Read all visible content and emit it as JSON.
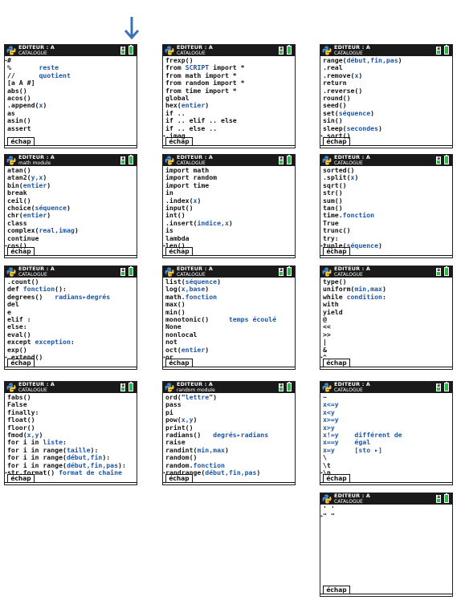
{
  "header": {
    "title": "ÉDITEUR : A",
    "subtitle_catalog": "CATALOGUE",
    "subtitle_math": "math module",
    "subtitle_random": "random module",
    "mode_indicator": "a"
  },
  "footer": {
    "escape_label": "échap"
  },
  "colors": {
    "header_bg": "#1a1a1a",
    "accent_blue": "#1c56a6",
    "battery_green": "#2db84a"
  },
  "screens": [
    {
      "subtitle": "CATALOGUE",
      "rows": [
        [
          {
            "t": "#"
          }
        ],
        [
          {
            "t": "%       "
          },
          {
            "t": "reste",
            "c": "blue"
          }
        ],
        [
          {
            "t": "//      "
          },
          {
            "t": "quotient",
            "c": "blue"
          }
        ],
        [
          {
            "t": "[a A #]"
          }
        ],
        [
          {
            "t": "abs()"
          }
        ],
        [
          {
            "t": "acos()"
          }
        ],
        [
          {
            "t": ".append("
          },
          {
            "t": "x",
            "c": "blue"
          },
          {
            "t": ")"
          }
        ],
        [
          {
            "t": "as"
          }
        ],
        [
          {
            "t": "asin()"
          }
        ],
        [
          {
            "t": "assert"
          }
        ]
      ],
      "markers": {
        "0": "▸"
      }
    },
    {
      "subtitle": "CATALOGUE",
      "rows": [
        [
          {
            "t": "frexp()"
          }
        ],
        [
          {
            "t": "from "
          },
          {
            "t": "SCRIPT",
            "c": "blue"
          },
          {
            "t": " import *"
          }
        ],
        [
          {
            "t": "from math import *"
          }
        ],
        [
          {
            "t": "from random import *"
          }
        ],
        [
          {
            "t": "from time import *"
          }
        ],
        [
          {
            "t": "global"
          }
        ],
        [
          {
            "t": "hex("
          },
          {
            "t": "entier",
            "c": "blue"
          },
          {
            "t": ")"
          }
        ],
        [
          {
            "t": "if .."
          }
        ],
        [
          {
            "t": "if .. elif .. else"
          }
        ],
        [
          {
            "t": "if .. else .."
          }
        ],
        [
          {
            "t": ".imag"
          }
        ]
      ],
      "markers": {
        "10": "▸"
      }
    },
    {
      "subtitle": "CATALOGUE",
      "rows": [
        [
          {
            "t": "range("
          },
          {
            "t": "début,fin,pas",
            "c": "blue"
          },
          {
            "t": ")"
          }
        ],
        [
          {
            "t": ".real"
          }
        ],
        [
          {
            "t": ".remove("
          },
          {
            "t": "x",
            "c": "blue"
          },
          {
            "t": ")"
          }
        ],
        [
          {
            "t": "return"
          }
        ],
        [
          {
            "t": ".reverse()"
          }
        ],
        [
          {
            "t": "round()"
          }
        ],
        [
          {
            "t": "seed()"
          }
        ],
        [
          {
            "t": "set("
          },
          {
            "t": "séquence",
            "c": "blue"
          },
          {
            "t": ")"
          }
        ],
        [
          {
            "t": "sin()"
          }
        ],
        [
          {
            "t": "sleep("
          },
          {
            "t": "secondes",
            "c": "blue"
          },
          {
            "t": ")"
          }
        ],
        [
          {
            "t": ".sort()"
          }
        ]
      ],
      "markers": {
        "10": "▸"
      }
    },
    {
      "subtitle": "math module",
      "rows": [
        [
          {
            "t": "atan()"
          }
        ],
        [
          {
            "t": "atan2("
          },
          {
            "t": "y,x",
            "c": "blue"
          },
          {
            "t": ")"
          }
        ],
        [
          {
            "t": "bin("
          },
          {
            "t": "entier",
            "c": "blue"
          },
          {
            "t": ")"
          }
        ],
        [
          {
            "t": "break"
          }
        ],
        [
          {
            "t": "ceil()"
          }
        ],
        [
          {
            "t": "choice("
          },
          {
            "t": "séquence",
            "c": "blue"
          },
          {
            "t": ")"
          }
        ],
        [
          {
            "t": "chr("
          },
          {
            "t": "entier",
            "c": "blue"
          },
          {
            "t": ")"
          }
        ],
        [
          {
            "t": "class"
          }
        ],
        [
          {
            "t": "complex("
          },
          {
            "t": "real,imag",
            "c": "blue"
          },
          {
            "t": ")"
          }
        ],
        [
          {
            "t": "continue"
          }
        ],
        [
          {
            "t": "cos()"
          }
        ]
      ],
      "markers": {
        "10": "▸"
      }
    },
    {
      "subtitle": "CATALOGUE",
      "rows": [
        [
          {
            "t": "import math"
          }
        ],
        [
          {
            "t": "import random"
          }
        ],
        [
          {
            "t": "import time"
          }
        ],
        [
          {
            "t": "in"
          }
        ],
        [
          {
            "t": ".index("
          },
          {
            "t": "x",
            "c": "blue"
          },
          {
            "t": ")"
          }
        ],
        [
          {
            "t": "input()"
          }
        ],
        [
          {
            "t": "int()"
          }
        ],
        [
          {
            "t": ".insert("
          },
          {
            "t": "indice,x",
            "c": "blue"
          },
          {
            "t": ")"
          }
        ],
        [
          {
            "t": "is"
          }
        ],
        [
          {
            "t": "lambda"
          }
        ],
        [
          {
            "t": "len()"
          }
        ]
      ],
      "markers": {
        "10": "▸"
      }
    },
    {
      "subtitle": "CATALOGUE",
      "rows": [
        [
          {
            "t": "sorted()"
          }
        ],
        [
          {
            "t": ".split("
          },
          {
            "t": "x",
            "c": "blue"
          },
          {
            "t": ")"
          }
        ],
        [
          {
            "t": "sqrt()"
          }
        ],
        [
          {
            "t": "str()"
          }
        ],
        [
          {
            "t": "sum()"
          }
        ],
        [
          {
            "t": "tan()"
          }
        ],
        [
          {
            "t": "time."
          },
          {
            "t": "fonction",
            "c": "blue"
          }
        ],
        [
          {
            "t": "True"
          }
        ],
        [
          {
            "t": "trunc()"
          }
        ],
        [
          {
            "t": "try:"
          }
        ],
        [
          {
            "t": "tuple("
          },
          {
            "t": "séquence",
            "c": "blue"
          },
          {
            "t": ")"
          }
        ]
      ],
      "markers": {
        "10": "▸"
      }
    },
    {
      "subtitle": "CATALOGUE",
      "rows": [
        [
          {
            "t": ".count()"
          }
        ],
        [
          {
            "t": "def "
          },
          {
            "t": "fonction",
            "c": "blue"
          },
          {
            "t": "():"
          }
        ],
        [
          {
            "t": "degrees()   "
          },
          {
            "t": "radians▸degrés",
            "c": "blue"
          }
        ],
        [
          {
            "t": "del"
          }
        ],
        [
          {
            "t": "e"
          }
        ],
        [
          {
            "t": "elif :"
          }
        ],
        [
          {
            "t": "else:"
          }
        ],
        [
          {
            "t": "eval()"
          }
        ],
        [
          {
            "t": "except "
          },
          {
            "t": "exception",
            "c": "blue"
          },
          {
            "t": ":"
          }
        ],
        [
          {
            "t": "exp()"
          }
        ],
        [
          {
            "t": ".extend()"
          }
        ]
      ],
      "markers": {
        "10": "▸"
      }
    },
    {
      "subtitle": "CATALOGUE",
      "rows": [
        [
          {
            "t": "list("
          },
          {
            "t": "séquence",
            "c": "blue"
          },
          {
            "t": ")"
          }
        ],
        [
          {
            "t": "log("
          },
          {
            "t": "x,base",
            "c": "blue"
          },
          {
            "t": ")"
          }
        ],
        [
          {
            "t": "math."
          },
          {
            "t": "fonction",
            "c": "blue"
          }
        ],
        [
          {
            "t": "max()"
          }
        ],
        [
          {
            "t": "min()"
          }
        ],
        [
          {
            "t": "monotonic()     "
          },
          {
            "t": "temps écoulé",
            "c": "blue"
          }
        ],
        [
          {
            "t": "None"
          }
        ],
        [
          {
            "t": "nonlocal"
          }
        ],
        [
          {
            "t": "not"
          }
        ],
        [
          {
            "t": "oct("
          },
          {
            "t": "entier",
            "c": "blue"
          },
          {
            "t": ")"
          }
        ],
        [
          {
            "t": "or"
          }
        ]
      ],
      "markers": {
        "10": "▸"
      }
    },
    {
      "subtitle": "CATALOGUE",
      "rows": [
        [
          {
            "t": "type()"
          }
        ],
        [
          {
            "t": "uniform("
          },
          {
            "t": "min,max",
            "c": "blue"
          },
          {
            "t": ")"
          }
        ],
        [
          {
            "t": "while "
          },
          {
            "t": "condition",
            "c": "blue"
          },
          {
            "t": ":"
          }
        ],
        [
          {
            "t": "with"
          }
        ],
        [
          {
            "t": "yield"
          }
        ],
        [
          {
            "t": "@"
          }
        ],
        [
          {
            "t": "<<"
          }
        ],
        [
          {
            "t": ">>"
          }
        ],
        [
          {
            "t": "|"
          }
        ],
        [
          {
            "t": "&"
          }
        ],
        [
          {
            "t": "^"
          }
        ]
      ],
      "markers": {
        "10": "▸"
      }
    },
    {
      "subtitle": "CATALOGUE",
      "rows": [
        [
          {
            "t": "fabs()"
          }
        ],
        [
          {
            "t": "False"
          }
        ],
        [
          {
            "t": "finally:"
          }
        ],
        [
          {
            "t": "float()"
          }
        ],
        [
          {
            "t": "floor()"
          }
        ],
        [
          {
            "t": "fmod("
          },
          {
            "t": "x,y",
            "c": "blue"
          },
          {
            "t": ")"
          }
        ],
        [
          {
            "t": "for i in "
          },
          {
            "t": "liste",
            "c": "blue"
          },
          {
            "t": ":"
          }
        ],
        [
          {
            "t": "for i in range("
          },
          {
            "t": "taille",
            "c": "blue"
          },
          {
            "t": "):"
          }
        ],
        [
          {
            "t": "for i in range("
          },
          {
            "t": "début,fin",
            "c": "blue"
          },
          {
            "t": "):"
          }
        ],
        [
          {
            "t": "for i in range("
          },
          {
            "t": "début,fin,pas",
            "c": "blue"
          },
          {
            "t": "):"
          }
        ],
        [
          {
            "t": "str.format() "
          },
          {
            "t": "format de chaîne",
            "c": "blue"
          }
        ]
      ],
      "markers": {
        "10": "▸"
      }
    },
    {
      "subtitle": "random module",
      "rows": [
        [
          {
            "t": "ord(\""
          },
          {
            "t": "lettre",
            "c": "blue"
          },
          {
            "t": "\")"
          }
        ],
        [
          {
            "t": "pass"
          }
        ],
        [
          {
            "t": "pi"
          }
        ],
        [
          {
            "t": "pow("
          },
          {
            "t": "x,y",
            "c": "blue"
          },
          {
            "t": ")"
          }
        ],
        [
          {
            "t": "print()"
          }
        ],
        [
          {
            "t": "radians()   "
          },
          {
            "t": "degrés▸radians",
            "c": "blue"
          }
        ],
        [
          {
            "t": "raise"
          }
        ],
        [
          {
            "t": "randint("
          },
          {
            "t": "min,max",
            "c": "blue"
          },
          {
            "t": ")"
          }
        ],
        [
          {
            "t": "random()"
          }
        ],
        [
          {
            "t": "random."
          },
          {
            "t": "fonction",
            "c": "blue"
          }
        ],
        [
          {
            "t": "randrange("
          },
          {
            "t": "début,fin,pas",
            "c": "blue"
          },
          {
            "t": ")"
          }
        ]
      ],
      "markers": {
        "10": "▸"
      }
    },
    {
      "subtitle": "CATALOGUE",
      "rows": [
        [
          {
            "t": "~"
          }
        ],
        [
          {
            "t": "x<=y",
            "c": "blue"
          }
        ],
        [
          {
            "t": "x<y",
            "c": "blue"
          }
        ],
        [
          {
            "t": "x>=y",
            "c": "blue"
          }
        ],
        [
          {
            "t": "x>y",
            "c": "blue"
          }
        ],
        [
          {
            "t": "x!=y    différent de",
            "c": "blue"
          }
        ],
        [
          {
            "t": "x==y    égal",
            "c": "blue"
          }
        ],
        [
          {
            "t": "x=y     [sto ▸]",
            "c": "blue"
          }
        ],
        [
          {
            "t": "\\"
          }
        ],
        [
          {
            "t": "\\t"
          }
        ],
        [
          {
            "t": "\\n"
          }
        ]
      ],
      "markers": {
        "10": "▸"
      }
    },
    {
      "subtitle": "CATALOGUE",
      "rows": [
        [
          {
            "t": "' '"
          }
        ],
        [
          {
            "t": "\" \""
          }
        ]
      ],
      "markers": {
        "1": "▸"
      }
    }
  ]
}
